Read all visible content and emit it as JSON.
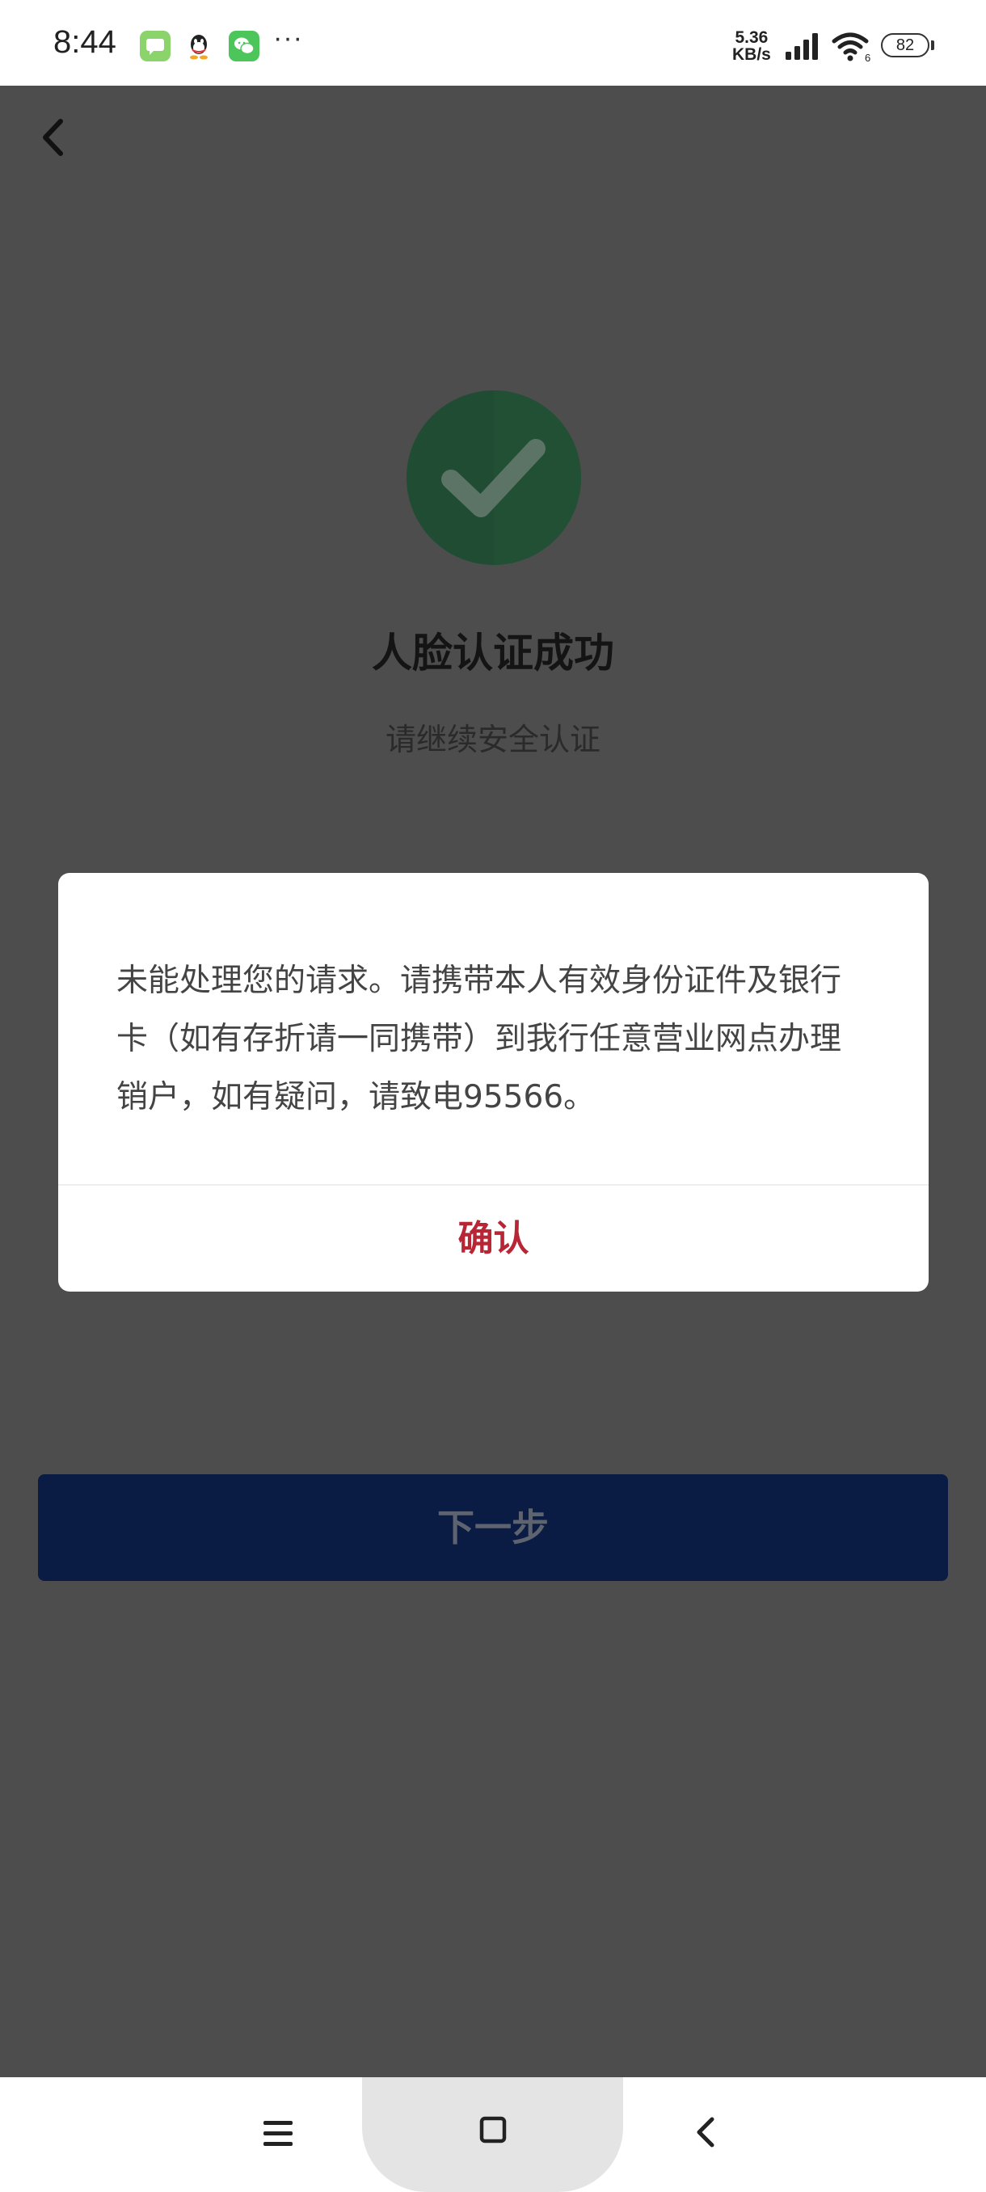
{
  "status_bar": {
    "time": "8:44",
    "more_indicator": "···",
    "net_speed_value": "5.36",
    "net_speed_unit": "KB/s",
    "battery_level": "82",
    "icons": [
      "message-icon",
      "qq-icon",
      "wechat-icon",
      "signal-icon",
      "wifi-icon",
      "battery-icon"
    ]
  },
  "header": {
    "back_icon": "chevron-left-icon"
  },
  "result": {
    "icon": "check-circle-icon",
    "title": "人脸认证成功",
    "subtitle": "请继续安全认证"
  },
  "actions": {
    "next_label": "下一步"
  },
  "dialog": {
    "message": "未能处理您的请求。请携带本人有效身份证件及银行卡（如有存折请一同携带）到我行任意营业网点办理销户，如有疑问，请致电95566。",
    "confirm_label": "确认"
  },
  "nav_bar": {
    "icons": [
      "menu-icon",
      "home-icon",
      "back-icon"
    ]
  },
  "colors": {
    "overlay_background": "#4d4d4d",
    "success_green": "#1f4c33",
    "primary_button": "#0a1c44",
    "confirm_red": "#b82535"
  }
}
